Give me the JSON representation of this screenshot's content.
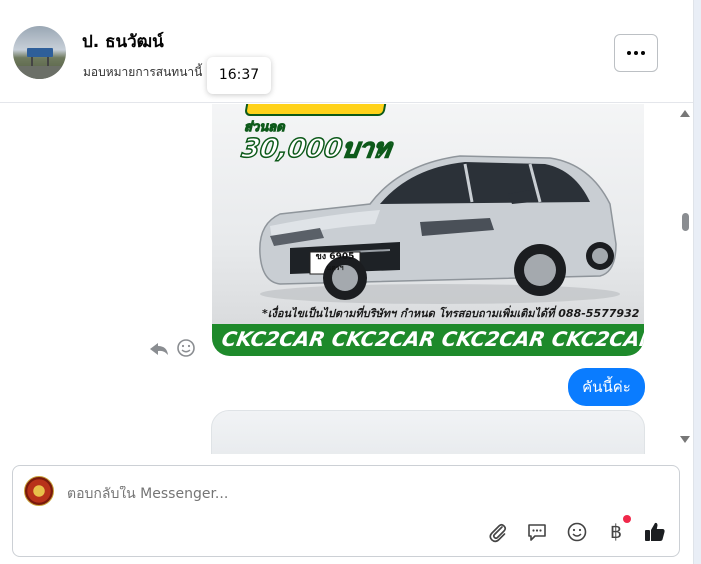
{
  "header": {
    "contact_name": "ป. ธนวัฒน์",
    "subtitle": "มอบหมายการสนทนานี้",
    "time_tooltip": "16:37",
    "more_icon": "more-dots-icon"
  },
  "chat": {
    "image_message": {
      "promo_small": "ส่วนลด",
      "promo_amount": "30,000บาท",
      "plate_line1": "ขง 6905",
      "plate_line2": "นครฯ",
      "disclaimer": "*เงื่อนไขเป็นไปตามที่บริษัทฯ กำหนด โทรสอบถามเพิ่มเติมได้ที่ 088-5577932",
      "banner_text": "CKC2CAR CKC2CAR CKC2CAR CKC2CAR CKC2",
      "reaction_icons": [
        "reply-icon",
        "emoji-icon"
      ]
    },
    "sent_bubble": "คันนี้ค่ะ"
  },
  "composer": {
    "placeholder": "ตอบกลับใน Messenger...",
    "tools": [
      "attach-icon",
      "saved-reply-icon",
      "emoji-icon",
      "baht-icon",
      "like-icon"
    ],
    "baht_symbol": "฿"
  },
  "colors": {
    "sent_bubble": "#0a7cff",
    "banner_green": "#1e8a2b",
    "notification_dot": "#f0284a"
  }
}
